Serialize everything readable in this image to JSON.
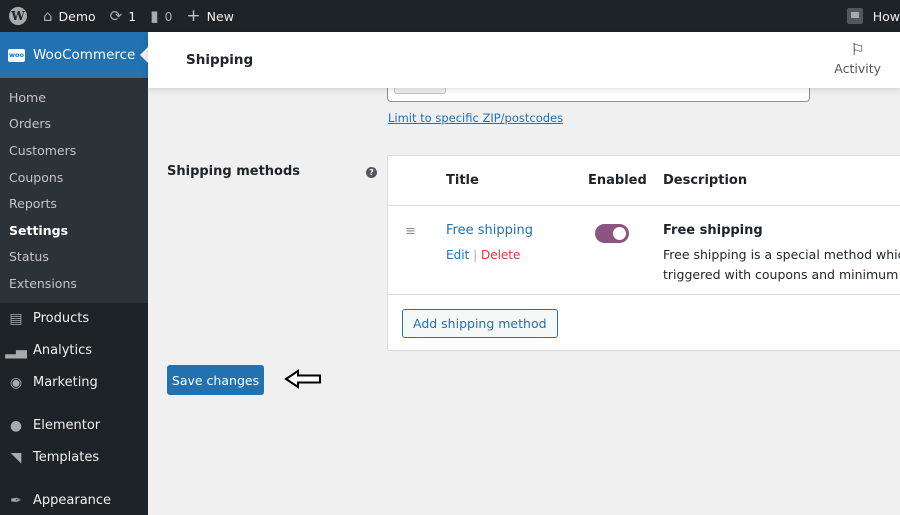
{
  "adminbar": {
    "site_name": "Demo",
    "updates_count": "1",
    "comments_count": "0",
    "new_label": "New",
    "howdy_label": "How"
  },
  "sidebar": {
    "woocommerce_label": "WooCommerce",
    "woo_logo_text": "woo",
    "submenu": [
      {
        "label": "Home",
        "current": false
      },
      {
        "label": "Orders",
        "current": false
      },
      {
        "label": "Customers",
        "current": false
      },
      {
        "label": "Coupons",
        "current": false
      },
      {
        "label": "Reports",
        "current": false
      },
      {
        "label": "Settings",
        "current": true
      },
      {
        "label": "Status",
        "current": false
      },
      {
        "label": "Extensions",
        "current": false
      }
    ],
    "menu": [
      {
        "label": "Products",
        "icon": "archive-icon"
      },
      {
        "label": "Analytics",
        "icon": "bar-chart-icon"
      },
      {
        "label": "Marketing",
        "icon": "megaphone-icon"
      },
      {
        "label": "Elementor",
        "icon": "elementor-icon"
      },
      {
        "label": "Templates",
        "icon": "folder-icon"
      },
      {
        "label": "Appearance",
        "icon": "paintbrush-icon"
      }
    ]
  },
  "header": {
    "title": "Shipping",
    "activity_label": "Activity"
  },
  "zone": {
    "limit_link": "Limit to specific ZIP/postcodes"
  },
  "shipping_methods": {
    "label": "Shipping methods",
    "help_glyph": "?",
    "columns": {
      "title": "Title",
      "enabled": "Enabled",
      "description": "Description"
    },
    "rows": [
      {
        "title": "Free shipping",
        "edit_label": "Edit",
        "separator": "|",
        "delete_label": "Delete",
        "enabled": true,
        "description_title": "Free shipping",
        "description_line1": "Free shipping is a special method which c",
        "description_line2": "triggered with coupons and minimum sp"
      }
    ],
    "add_button": "Add shipping method"
  },
  "footer": {
    "save_button": "Save changes"
  },
  "colors": {
    "accent": "#2271b1",
    "toggle_on": "#8c5383",
    "delete": "#d63638",
    "adminbar_bg": "#1d2327"
  }
}
